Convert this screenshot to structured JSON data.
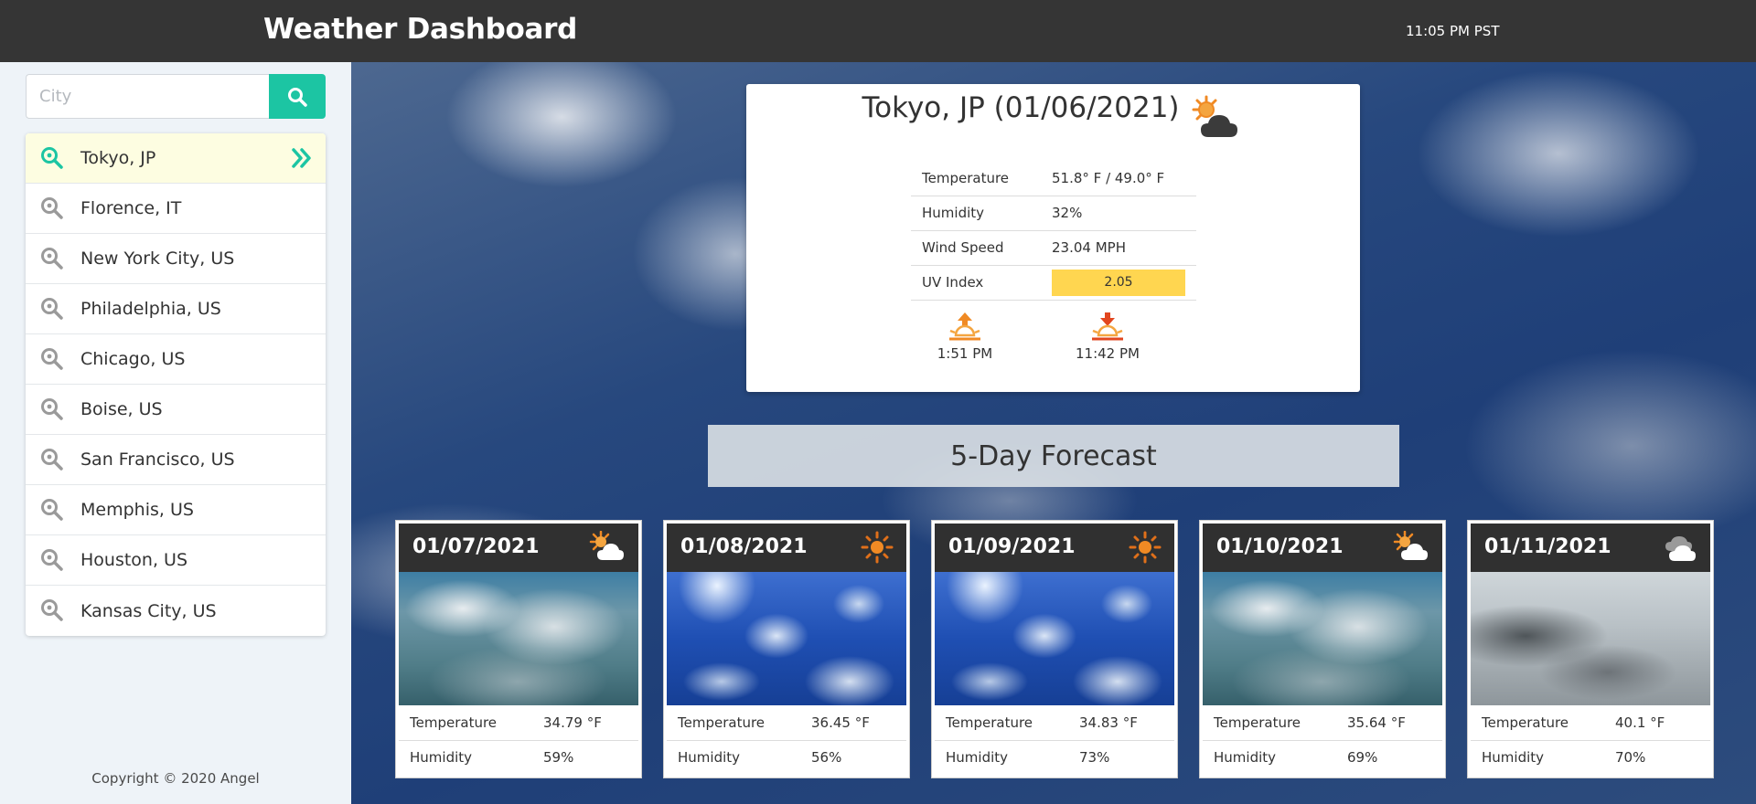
{
  "header": {
    "title": "Weather Dashboard",
    "time": "11:05 PM PST"
  },
  "sidebar": {
    "search": {
      "placeholder": "City",
      "value": ""
    },
    "cities": [
      {
        "label": "Tokyo, JP",
        "active": true
      },
      {
        "label": "Florence, IT"
      },
      {
        "label": "New York City, US"
      },
      {
        "label": "Philadelphia, US"
      },
      {
        "label": "Chicago, US"
      },
      {
        "label": "Boise, US"
      },
      {
        "label": "San Francisco, US"
      },
      {
        "label": "Memphis, US"
      },
      {
        "label": "Houston, US"
      },
      {
        "label": "Kansas City, US"
      }
    ],
    "copyright": "Copyright © 2020 Angel"
  },
  "current": {
    "title": "Tokyo, JP (01/06/2021)",
    "icon": "partly-cloudy-icon",
    "rows": [
      {
        "label": "Temperature",
        "value": "51.8° F / 49.0° F"
      },
      {
        "label": "Humidity",
        "value": "32%"
      },
      {
        "label": "Wind Speed",
        "value": "23.04 MPH"
      },
      {
        "label": "UV Index",
        "value": "2.05"
      }
    ],
    "uv_color": "#ffd650",
    "sunrise": "1:51 PM",
    "sunset": "11:42 PM"
  },
  "forecast": {
    "heading": "5-Day Forecast",
    "days": [
      {
        "date": "01/07/2021",
        "icon": "partly-cloudy-icon",
        "photo": "cloudy",
        "temp_label": "Temperature",
        "temp": "34.79 °F",
        "hum_label": "Humidity",
        "humidity": "59%"
      },
      {
        "date": "01/08/2021",
        "icon": "sun-icon",
        "photo": "sunny",
        "temp_label": "Temperature",
        "temp": "36.45 °F",
        "hum_label": "Humidity",
        "humidity": "56%"
      },
      {
        "date": "01/09/2021",
        "icon": "sun-icon",
        "photo": "sunny",
        "temp_label": "Temperature",
        "temp": "34.83 °F",
        "hum_label": "Humidity",
        "humidity": "73%"
      },
      {
        "date": "01/10/2021",
        "icon": "partly-cloudy-icon",
        "photo": "cloudy",
        "temp_label": "Temperature",
        "temp": "35.64 °F",
        "hum_label": "Humidity",
        "humidity": "69%"
      },
      {
        "date": "01/11/2021",
        "icon": "cloudy-icon",
        "photo": "overcast",
        "temp_label": "Temperature",
        "temp": "40.1 °F",
        "hum_label": "Humidity",
        "humidity": "70%"
      }
    ]
  },
  "colors": {
    "header_bg": "#353535",
    "accent": "#1cc5a3",
    "active_city_bg": "#fdfde1",
    "sun_orange": "#f08a24"
  }
}
